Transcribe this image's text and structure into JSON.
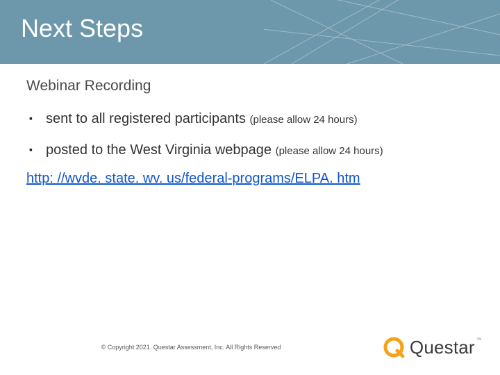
{
  "title": "Next Steps",
  "subtitle": "Webinar Recording",
  "bullets": [
    {
      "main": "sent to all registered participants ",
      "note": "(please allow 24 hours)"
    },
    {
      "main": "posted to the West Virginia webpage ",
      "note": "(please allow 24 hours)"
    }
  ],
  "link": {
    "text": "http: //wvde. state. wv. us/federal-programs/ELPA. htm",
    "href": "http://wvde.state.wv.us/federal-programs/ELPA.htm"
  },
  "footer": {
    "copyright": "© Copyright 2021.  Questar Assessment, Inc. All Rights Reserved"
  },
  "logo": {
    "text": "Questar",
    "tm": "™"
  }
}
